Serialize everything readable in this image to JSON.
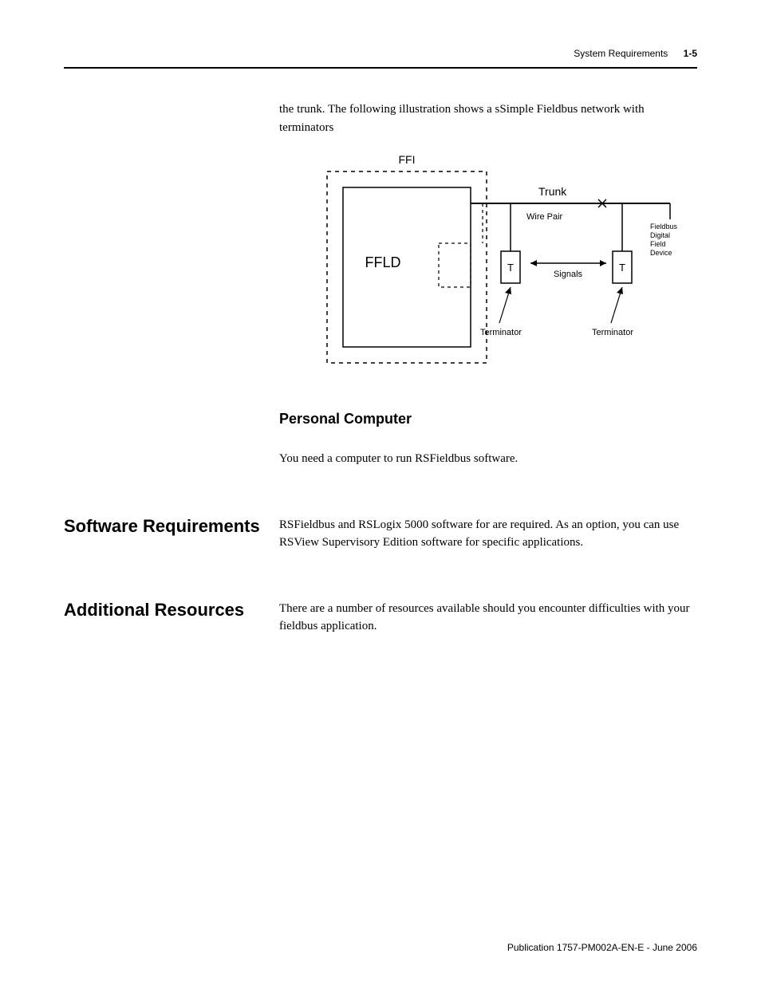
{
  "header": {
    "title": "System Requirements",
    "pagenum": "1-5"
  },
  "intro": "the trunk. The following illustration shows a sSimple Fieldbus network with terminators",
  "diagram": {
    "ffi": "FFI",
    "ffld": "FFLD",
    "trunk": "Trunk",
    "wirepair": "Wire Pair",
    "t1": "T",
    "t2": "T",
    "signals": "Signals",
    "terminator1": "Terminator",
    "terminator2": "Terminator",
    "device": "Fieldbus\nDigital\nField\nDevice"
  },
  "subhead_pc": "Personal Computer",
  "pc_text": "You need a computer to run RSFieldbus software.",
  "section_software": {
    "label": "Software Requirements",
    "body": "RSFieldbus and RSLogix 5000 software for are required. As an option, you can use RSView Supervisory Edition software for specific applications."
  },
  "section_resources": {
    "label": "Additional Resources",
    "body": "There are a number of resources available should you encounter difficulties with your fieldbus application."
  },
  "footer": "Publication 1757-PM002A-EN-E - June 2006"
}
